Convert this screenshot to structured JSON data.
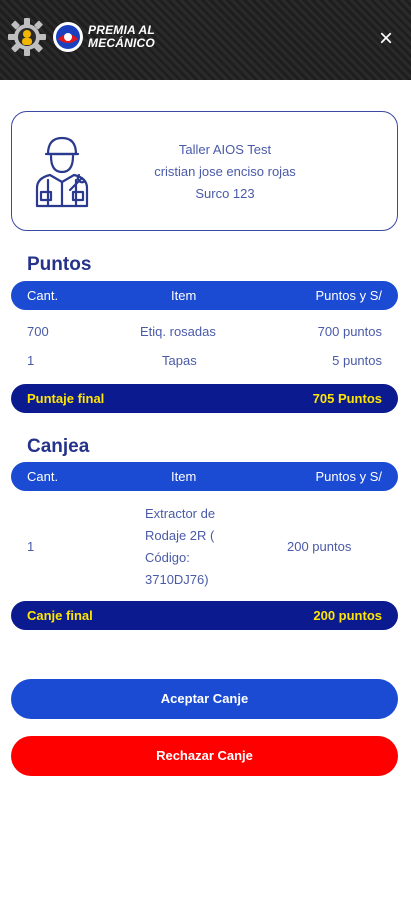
{
  "header": {
    "logo_text_line1": "PREMIA AL",
    "logo_text_line2": "MECÁNICO",
    "close_label": "×"
  },
  "profile": {
    "workshop": "Taller AIOS Test",
    "name": "cristian jose enciso rojas",
    "address": "Surco 123"
  },
  "puntos": {
    "title": "Puntos",
    "columns": [
      "Cant.",
      "Item",
      "Puntos y S/"
    ],
    "rows": [
      {
        "qty": "700",
        "item": "Etiq. rosadas",
        "points": "700 puntos"
      },
      {
        "qty": "1",
        "item": "Tapas",
        "points": "5 puntos"
      }
    ],
    "total_label": "Puntaje final",
    "total_value": "705 Puntos"
  },
  "canjea": {
    "title": "Canjea",
    "columns": [
      "Cant.",
      "Item",
      "Puntos y S/"
    ],
    "rows": [
      {
        "qty": "1",
        "item_lines": [
          "Extractor de",
          "Rodaje 2R (",
          "Código:",
          "3710DJ76)"
        ],
        "points": "200 puntos"
      }
    ],
    "total_label": "Canje final",
    "total_value": "200 puntos"
  },
  "actions": {
    "accept": "Aceptar Canje",
    "reject": "Rechazar Canje"
  },
  "colors": {
    "primary_blue": "#1a4bd2",
    "dark_navy": "#0b1a8f",
    "total_text": "#ffe600",
    "reject_red": "#ff0000"
  }
}
